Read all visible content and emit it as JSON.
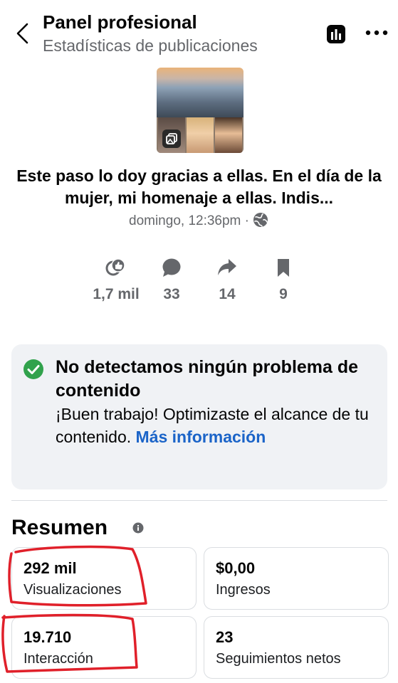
{
  "header": {
    "title": "Panel profesional",
    "subtitle": "Estadísticas de publicaciones"
  },
  "post": {
    "text": "Este paso lo doy gracias a ellas. En el día de la mujer,  mi homenaje a ellas. Indis...",
    "date": "domingo, 12:36pm ·"
  },
  "stats": [
    {
      "icon": "reactions-icon",
      "value": "1,7 mil"
    },
    {
      "icon": "comment-icon",
      "value": "33"
    },
    {
      "icon": "share-icon",
      "value": "14"
    },
    {
      "icon": "bookmark-icon",
      "value": "9"
    }
  ],
  "notice": {
    "title": "No detectamos ningún problema de contenido",
    "body": "¡Buen trabajo! Optimizaste el alcance de tu contenido.",
    "link": "Más información"
  },
  "summary": {
    "title": "Resumen",
    "cards": [
      {
        "value": "292 mil",
        "label": "Visualizaciones"
      },
      {
        "value": "$0,00",
        "label": "Ingresos"
      },
      {
        "value": "19.710",
        "label": "Interacción"
      },
      {
        "value": "23",
        "label": "Seguimientos netos"
      }
    ]
  },
  "colors": {
    "link": "#1b64c8",
    "success": "#31a24c",
    "annotation": "#e0202a",
    "muted": "#65676b",
    "notice_bg": "#f0f2f5"
  }
}
